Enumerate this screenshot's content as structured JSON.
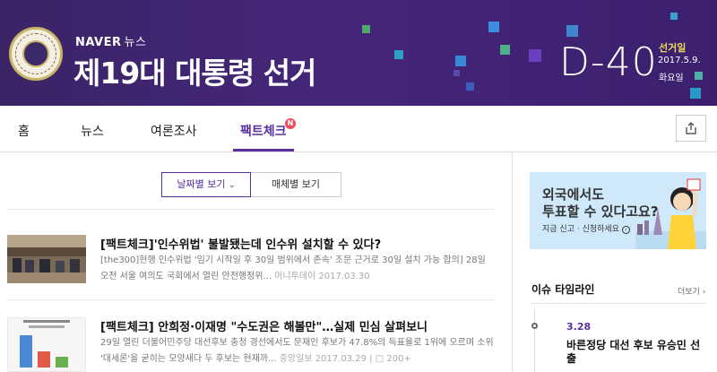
{
  "banner": {
    "brand": "NAVER",
    "brand_sub": "뉴스",
    "title": "제19대 대통령 선거",
    "dday": "D-40",
    "election_label": "선거일",
    "election_date": "2017.5.9.",
    "election_dow": "화요일"
  },
  "nav": {
    "items": [
      "홈",
      "뉴스",
      "여론조사",
      "팩트체크"
    ],
    "active_index": 3,
    "new_badge": "N"
  },
  "filters": {
    "by_date": "날짜별 보기",
    "by_media": "매체별 보기"
  },
  "articles": [
    {
      "title": "[팩트체크]'인수위법' 불발됐는데 인수위 설치할 수 있다?",
      "summary": "[the300]현행 인수위법 '임기 시작일 후 30일 범위에서 존속' 조문 근거로 30일 설치 가능 합의] 28일 오전 서울 여의도 국회에서 열린 안전행정위...",
      "source": "머니투데이 2017.03.30"
    },
    {
      "title": "[팩트체크] 안희정·이재명 \"수도권은 해볼만\"…실제 민심 살펴보니",
      "summary": "29일 열린 더불어민주당 대선후보 충청 경선에서도 문재인 후보가 47.8%의 득표율로 1위에 오르며 소위 '대세론'을 굳히는 모양새다 두 후보는 현재까...",
      "source": "중앙일보 2017.03.29",
      "comments": "200+"
    }
  ],
  "ad": {
    "line1": "외국에서도",
    "line2": "투표할 수 있다고요?",
    "cta": "지금 신고 · 신청하세요"
  },
  "issue": {
    "title": "이슈 타임라인",
    "more": "더보기",
    "date": "3.28",
    "text": "바른정당 대선 후보 유승민 선출"
  },
  "colors": {
    "banner": "#3d216f",
    "accent": "#5b2fa0",
    "new_badge": "#ef4b5e",
    "election_label": "#f0d85a"
  }
}
